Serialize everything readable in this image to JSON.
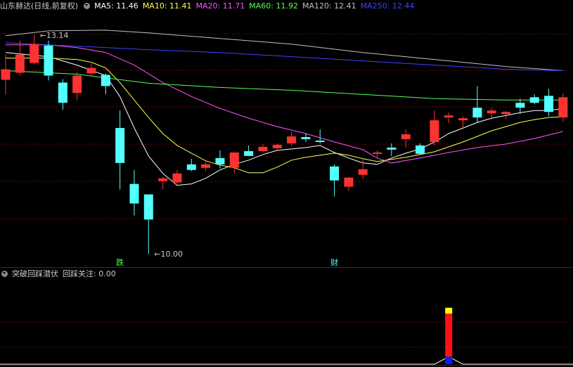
{
  "header": {
    "stock": "山东赫达(日线,前复权)",
    "ma_labels": [
      {
        "text": "MA5: 11.46",
        "color": "#ffffff"
      },
      {
        "text": "MA10: 11.41",
        "color": "#ffff55"
      },
      {
        "text": "MA20: 11.71",
        "color": "#ff55ff"
      },
      {
        "text": "MA60: 11.92",
        "color": "#55ff55"
      },
      {
        "text": "MA120: 12.41",
        "color": "#c0c0c0"
      },
      {
        "text": "MA250: 12.44",
        "color": "#4040ff"
      }
    ]
  },
  "indicator_header": {
    "name": "突破回踩潜伏",
    "value_label": "回踩关注: 0.00"
  },
  "colors": {
    "up": "#ff3232",
    "down": "#54ffff",
    "grid": "#7f0000",
    "divider": "#a00000",
    "bar_red": "#ff1010",
    "bar_yellow": "#ffff00",
    "bar_blue": "#0020ff"
  },
  "chart_data": {
    "type": "candlestick",
    "title": "山东赫达(日线,前复权)",
    "ylim": [
      9.95,
      13.45
    ],
    "candles": [
      {
        "o": 12.49,
        "h": 12.85,
        "l": 12.28,
        "c": 12.64
      },
      {
        "o": 12.59,
        "h": 13.05,
        "l": 12.55,
        "c": 12.85
      },
      {
        "o": 12.73,
        "h": 13.14,
        "l": 12.71,
        "c": 13.0
      },
      {
        "o": 12.98,
        "h": 13.05,
        "l": 12.48,
        "c": 12.55
      },
      {
        "o": 12.45,
        "h": 12.5,
        "l": 12.06,
        "c": 12.16
      },
      {
        "o": 12.3,
        "h": 12.6,
        "l": 12.2,
        "c": 12.55
      },
      {
        "o": 12.58,
        "h": 12.72,
        "l": 12.55,
        "c": 12.66
      },
      {
        "o": 12.56,
        "h": 12.58,
        "l": 12.28,
        "c": 12.4
      },
      {
        "o": 11.8,
        "h": 12.05,
        "l": 10.92,
        "c": 11.3
      },
      {
        "o": 11.0,
        "h": 11.2,
        "l": 10.55,
        "c": 10.72
      },
      {
        "o": 10.85,
        "h": 10.85,
        "l": 10.0,
        "c": 10.49
      },
      {
        "o": 11.04,
        "h": 11.1,
        "l": 10.93,
        "c": 11.08
      },
      {
        "o": 11.02,
        "h": 11.2,
        "l": 11.0,
        "c": 11.15
      },
      {
        "o": 11.28,
        "h": 11.36,
        "l": 11.18,
        "c": 11.2
      },
      {
        "o": 11.23,
        "h": 11.35,
        "l": 11.18,
        "c": 11.28
      },
      {
        "o": 11.37,
        "h": 11.48,
        "l": 11.22,
        "c": 11.28
      },
      {
        "o": 11.23,
        "h": 11.45,
        "l": 11.15,
        "c": 11.45
      },
      {
        "o": 11.47,
        "h": 11.55,
        "l": 11.4,
        "c": 11.4
      },
      {
        "o": 11.47,
        "h": 11.57,
        "l": 11.45,
        "c": 11.53
      },
      {
        "o": 11.51,
        "h": 11.58,
        "l": 11.48,
        "c": 11.56
      },
      {
        "o": 11.58,
        "h": 11.75,
        "l": 11.54,
        "c": 11.68
      },
      {
        "o": 11.67,
        "h": 11.72,
        "l": 11.6,
        "c": 11.64
      },
      {
        "o": 11.62,
        "h": 11.78,
        "l": 11.58,
        "c": 11.6
      },
      {
        "o": 11.25,
        "h": 11.28,
        "l": 10.82,
        "c": 11.05
      },
      {
        "o": 10.96,
        "h": 11.1,
        "l": 10.9,
        "c": 11.09
      },
      {
        "o": 11.13,
        "h": 11.35,
        "l": 11.07,
        "c": 11.21
      },
      {
        "o": 11.43,
        "h": 11.48,
        "l": 11.38,
        "c": 11.45
      },
      {
        "o": 11.52,
        "h": 11.58,
        "l": 11.4,
        "c": 11.49
      },
      {
        "o": 11.64,
        "h": 11.78,
        "l": 11.52,
        "c": 11.71
      },
      {
        "o": 11.55,
        "h": 11.58,
        "l": 11.42,
        "c": 11.43
      },
      {
        "o": 11.6,
        "h": 12.05,
        "l": 11.55,
        "c": 11.91
      },
      {
        "o": 11.95,
        "h": 12.02,
        "l": 11.87,
        "c": 11.98
      },
      {
        "o": 11.91,
        "h": 11.97,
        "l": 11.78,
        "c": 11.94
      },
      {
        "o": 12.09,
        "h": 12.4,
        "l": 11.87,
        "c": 11.95
      },
      {
        "o": 12.01,
        "h": 12.09,
        "l": 11.92,
        "c": 12.05
      },
      {
        "o": 12.0,
        "h": 12.04,
        "l": 11.93,
        "c": 12.03
      },
      {
        "o": 12.16,
        "h": 12.22,
        "l": 12.0,
        "c": 12.09
      },
      {
        "o": 12.24,
        "h": 12.28,
        "l": 12.14,
        "c": 12.16
      },
      {
        "o": 12.26,
        "h": 12.36,
        "l": 11.97,
        "c": 12.03
      },
      {
        "o": 11.95,
        "h": 12.3,
        "l": 11.89,
        "c": 12.24
      }
    ],
    "ma": [
      {
        "name": "MA5",
        "color": "#ffffff",
        "points": [
          [
            0,
            12.88
          ],
          [
            3,
            12.82
          ],
          [
            5,
            12.7
          ],
          [
            7,
            12.55
          ],
          [
            8,
            12.25
          ],
          [
            9,
            11.8
          ],
          [
            10,
            11.4
          ],
          [
            11,
            11.15
          ],
          [
            12,
            10.98
          ],
          [
            13,
            11.0
          ],
          [
            14,
            11.08
          ],
          [
            15,
            11.2
          ],
          [
            16,
            11.28
          ],
          [
            17,
            11.34
          ],
          [
            18,
            11.42
          ],
          [
            19,
            11.48
          ],
          [
            20,
            11.5
          ],
          [
            21,
            11.52
          ],
          [
            22,
            11.55
          ],
          [
            23,
            11.45
          ],
          [
            24,
            11.37
          ],
          [
            25,
            11.3
          ],
          [
            26,
            11.28
          ],
          [
            27,
            11.37
          ],
          [
            28,
            11.44
          ],
          [
            29,
            11.5
          ],
          [
            30,
            11.6
          ],
          [
            31,
            11.72
          ],
          [
            32,
            11.8
          ],
          [
            33,
            11.88
          ],
          [
            34,
            11.94
          ],
          [
            35,
            11.98
          ],
          [
            36,
            12.02
          ],
          [
            37,
            12.05
          ],
          [
            38,
            12.05
          ],
          [
            39,
            12.08
          ]
        ]
      },
      {
        "name": "MA10",
        "color": "#ffff55",
        "points": [
          [
            0,
            12.8
          ],
          [
            3,
            12.8
          ],
          [
            5,
            12.78
          ],
          [
            6,
            12.74
          ],
          [
            7,
            12.66
          ],
          [
            8,
            12.45
          ],
          [
            9,
            12.2
          ],
          [
            10,
            11.95
          ],
          [
            11,
            11.72
          ],
          [
            12,
            11.55
          ],
          [
            13,
            11.44
          ],
          [
            14,
            11.33
          ],
          [
            15,
            11.27
          ],
          [
            16,
            11.23
          ],
          [
            17,
            11.16
          ],
          [
            18,
            11.16
          ],
          [
            19,
            11.24
          ],
          [
            20,
            11.34
          ],
          [
            21,
            11.38
          ],
          [
            22,
            11.41
          ],
          [
            23,
            11.44
          ],
          [
            24,
            11.41
          ],
          [
            25,
            11.36
          ],
          [
            26,
            11.32
          ],
          [
            27,
            11.35
          ],
          [
            28,
            11.38
          ],
          [
            29,
            11.42
          ],
          [
            30,
            11.46
          ],
          [
            31,
            11.53
          ],
          [
            32,
            11.6
          ],
          [
            33,
            11.68
          ],
          [
            34,
            11.76
          ],
          [
            35,
            11.82
          ],
          [
            36,
            11.88
          ],
          [
            37,
            11.92
          ],
          [
            38,
            11.95
          ],
          [
            39,
            11.96
          ]
        ]
      },
      {
        "name": "MA20",
        "color": "#ff55ff",
        "points": [
          [
            0,
            12.99
          ],
          [
            3,
            12.99
          ],
          [
            5,
            12.95
          ],
          [
            7,
            12.88
          ],
          [
            9,
            12.7
          ],
          [
            11,
            12.45
          ],
          [
            13,
            12.25
          ],
          [
            15,
            12.08
          ],
          [
            17,
            11.94
          ],
          [
            19,
            11.82
          ],
          [
            21,
            11.72
          ],
          [
            23,
            11.6
          ],
          [
            25,
            11.49
          ],
          [
            26,
            11.37
          ],
          [
            27,
            11.3
          ],
          [
            29,
            11.37
          ],
          [
            31,
            11.45
          ],
          [
            33,
            11.52
          ],
          [
            35,
            11.57
          ],
          [
            37,
            11.65
          ],
          [
            39,
            11.75
          ]
        ]
      },
      {
        "name": "MA60",
        "color": "#55ff55",
        "points": [
          [
            0,
            12.62
          ],
          [
            5,
            12.57
          ],
          [
            10,
            12.44
          ],
          [
            15,
            12.38
          ],
          [
            20,
            12.34
          ],
          [
            25,
            12.28
          ],
          [
            30,
            12.22
          ],
          [
            35,
            12.2
          ],
          [
            39,
            12.2
          ]
        ]
      },
      {
        "name": "MA120",
        "color": "#c0c0c0",
        "points": [
          [
            0,
            13.12
          ],
          [
            3,
            13.19
          ],
          [
            7,
            13.2
          ],
          [
            10,
            13.16
          ],
          [
            15,
            13.08
          ],
          [
            20,
            13.0
          ],
          [
            25,
            12.88
          ],
          [
            30,
            12.78
          ],
          [
            35,
            12.68
          ],
          [
            39,
            12.62
          ]
        ]
      },
      {
        "name": "MA250",
        "color": "#4040ff",
        "points": [
          [
            0,
            13.02
          ],
          [
            5,
            12.97
          ],
          [
            10,
            12.92
          ],
          [
            15,
            12.88
          ],
          [
            20,
            12.82
          ],
          [
            25,
            12.76
          ],
          [
            30,
            12.7
          ],
          [
            35,
            12.64
          ],
          [
            39,
            12.62
          ]
        ]
      }
    ],
    "annotations": [
      {
        "text": "13.14",
        "index": 2,
        "value": 13.14
      },
      {
        "text": "10.00",
        "index": 10,
        "value": 10.0
      }
    ],
    "markers": [
      {
        "text": "跌",
        "index": 8,
        "color": "#55ff55"
      },
      {
        "text": "财",
        "index": 23,
        "color": "#55ffff"
      }
    ],
    "indicator": {
      "ylim": [
        0,
        1
      ],
      "bar_index": 31,
      "bar_blue": 0.09,
      "bar_red": 0.52,
      "bar_yellow": 0.07,
      "baseline_peak": 0.09
    }
  }
}
